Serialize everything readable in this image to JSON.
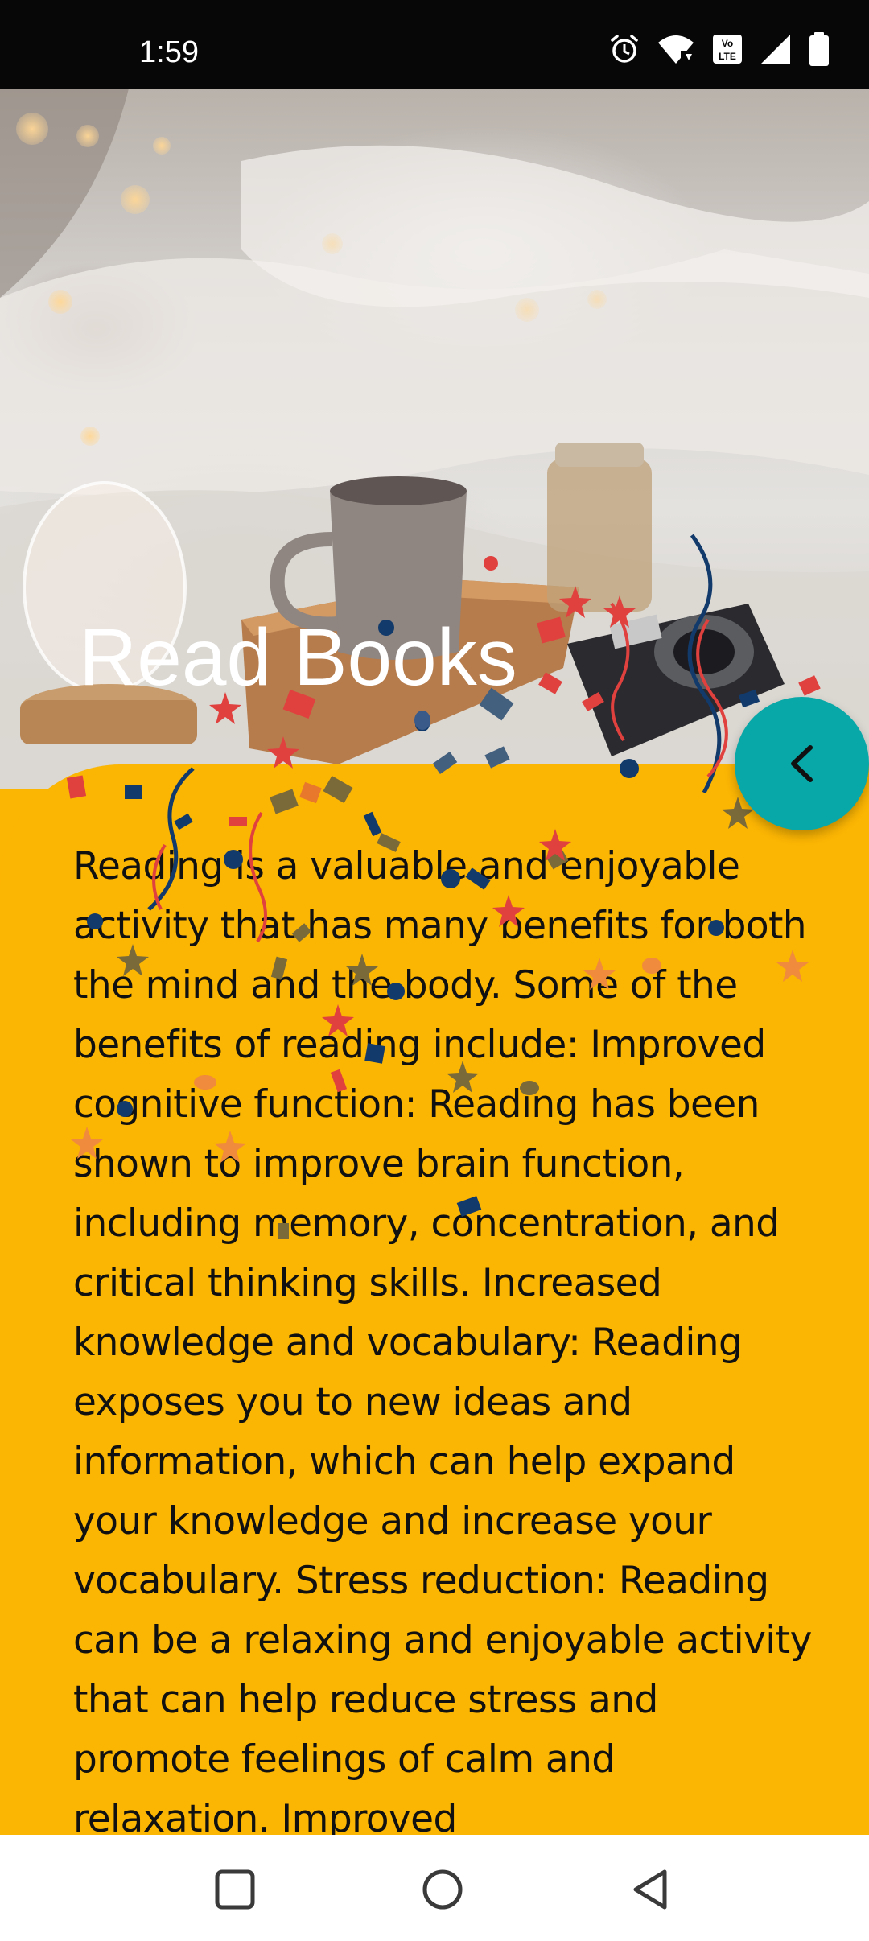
{
  "status_bar": {
    "time": "1:59",
    "icons": [
      "alarm-icon",
      "wifi-icon",
      "volte-icon",
      "signal-icon",
      "battery-icon"
    ],
    "volte_label": "Vo LTE"
  },
  "hero": {
    "title": "Read Books"
  },
  "article": {
    "body": "Reading is a valuable and enjoyable activity that has many benefits for both the mind and the body. Some of the benefits of reading include: Improved cognitive function: Reading has been shown to improve brain function, including memory, concentration, and critical thinking skills. Increased knowledge and vocabulary: Reading exposes you to new ideas and information, which can help expand your knowledge and increase your vocabulary. Stress reduction: Reading can be a relaxing and enjoyable activity that can help reduce stress and promote feelings of calm and relaxation. Improved"
  },
  "back_button": {
    "icon": "chevron-left-icon"
  },
  "nav_bar": {
    "buttons": [
      "recents-square-icon",
      "home-circle-icon",
      "back-triangle-icon"
    ]
  },
  "colors": {
    "accent_yellow": "#fbb503",
    "fab_teal": "#08a8a8",
    "status_bar": "#070707"
  }
}
